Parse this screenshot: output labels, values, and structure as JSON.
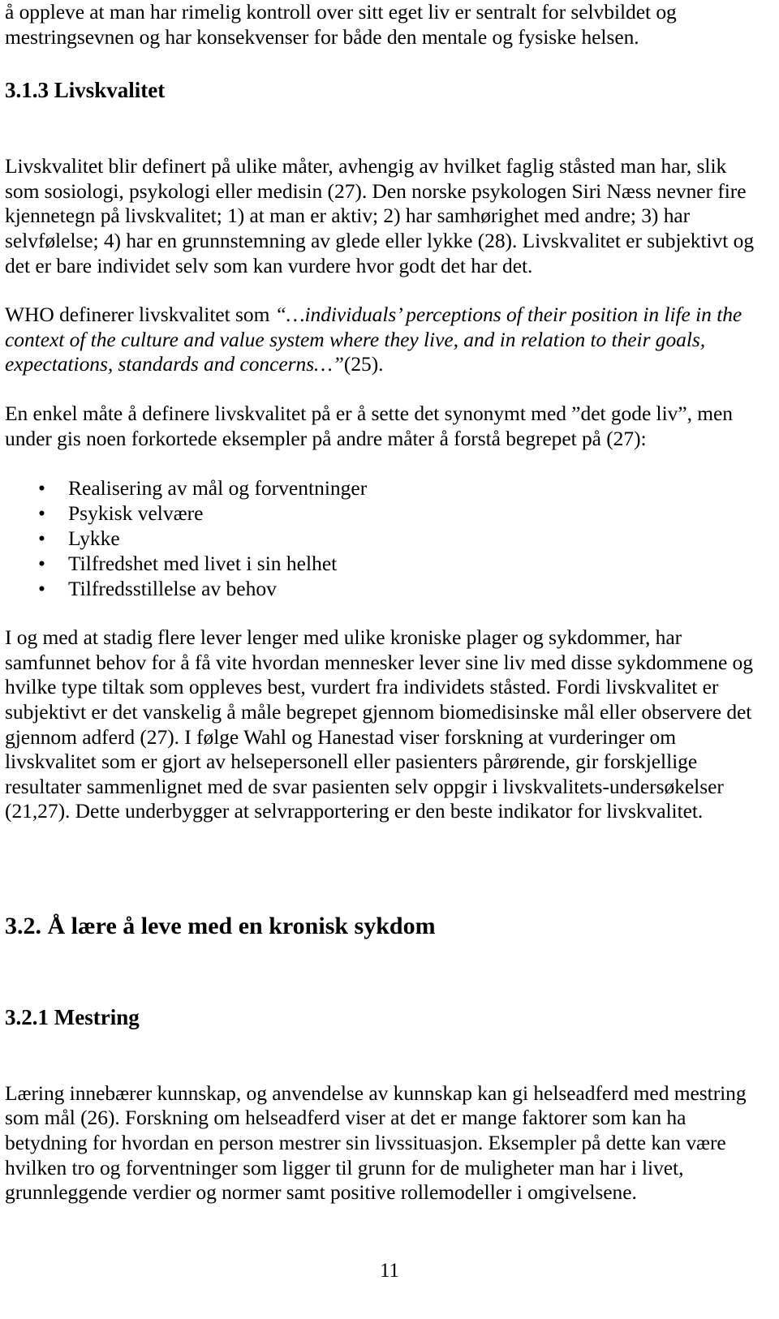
{
  "document": {
    "page_number": "11",
    "paragraphs": {
      "intro_continuation": "å oppleve at man har rimelig kontroll over sitt eget liv er sentralt for selvbildet og mestringsevnen og har konsekvenser for både den mentale og fysiske helsen.",
      "heading_313": "3.1.3 Livskvalitet",
      "livskvalitet_def": "Livskvalitet blir definert på ulike måter, avhengig av hvilket faglig ståsted man har, slik som sosiologi, psykologi eller medisin (27). Den norske psykologen Siri Næss  nevner fire kjennetegn på livskvalitet; 1) at man er aktiv; 2) har samhørighet med andre; 3) har selvfølelse; 4) har en grunnstemning av glede eller lykke (28). Livskvalitet er subjektivt og det er bare individet selv som kan vurdere hvor godt det har det.",
      "who_lead": "WHO definerer livskvalitet som ",
      "who_quote": "“…individuals’ perceptions of their position in life in the context of the culture and value system where they live, and in relation to their goals, expectations, standards and concerns…”",
      "who_ref": "(25).",
      "enkel_mate": "En enkel måte å definere livskvalitet på er å sette det synonymt med ”det gode liv”, men under gis noen forkortede eksempler på andre måter å forstå begrepet på (27):",
      "bullets": [
        "Realisering av mål og forventninger",
        "Psykisk velvære",
        "Lykke",
        "Tilfredshet med livet i sin helhet",
        "Tilfredsstillelse av behov"
      ],
      "stadig_flere": "I og med at stadig flere lever lenger med ulike kroniske plager og sykdommer, har samfunnet behov for å få vite hvordan mennesker lever sine liv med disse sykdommene og hvilke type tiltak som oppleves best, vurdert fra individets ståsted. Fordi livskvalitet er subjektivt er det vanskelig å måle begrepet gjennom biomedisinske mål eller observere det gjennom adferd (27). I følge Wahl og Hanestad viser forskning at vurderinger om livskvalitet som er gjort av helsepersonell eller pasienters pårørende, gir forskjellige resultater sammenlignet med de svar pasienten selv oppgir i livskvalitets-undersøkelser (21,27). Dette underbygger at selvrapportering er den beste indikator for livskvalitet.",
      "heading_32": "3.2. Å lære å leve med en kronisk sykdom",
      "heading_321": "3.2.1 Mestring",
      "mestring_text": "Læring innebærer kunnskap, og anvendelse av kunnskap kan gi helseadferd med mestring som mål (26). Forskning om helseadferd viser at det er mange faktorer som kan ha betydning for hvordan en person mestrer sin livssituasjon. Eksempler på dette kan være hvilken tro og forventninger som ligger til grunn for de muligheter man har i livet, grunnleggende verdier og normer samt positive rollemodeller i omgivelsene."
    },
    "bullet_glyph": "•"
  }
}
